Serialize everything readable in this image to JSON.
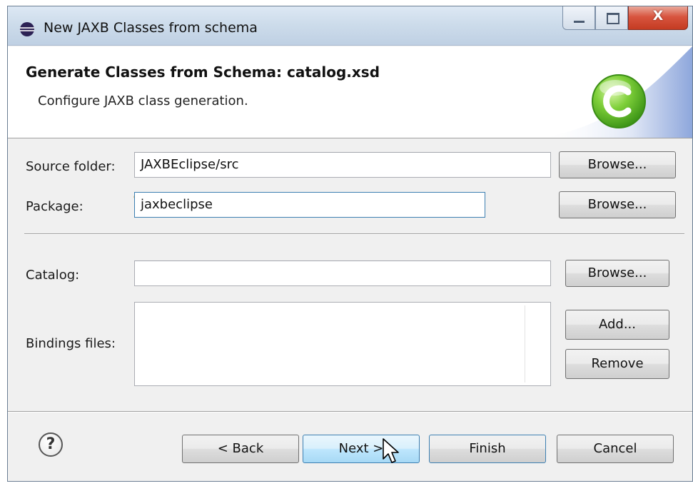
{
  "window": {
    "title": "New JAXB Classes from schema",
    "close_glyph": "X"
  },
  "header": {
    "title": "Generate Classes from Schema: catalog.xsd",
    "description": "Configure JAXB class generation.",
    "logo_icon": "eclipse-class-c-icon"
  },
  "form": {
    "source_folder": {
      "label": "Source folder:",
      "value": "JAXBEclipse/src",
      "browse_label": "Browse..."
    },
    "package": {
      "label": "Package:",
      "value": "jaxbeclipse",
      "browse_label": "Browse..."
    },
    "catalog": {
      "label": "Catalog:",
      "value": "",
      "browse_label": "Browse..."
    },
    "bindings": {
      "label": "Bindings files:",
      "add_label": "Add...",
      "remove_label": "Remove",
      "items": []
    }
  },
  "footer": {
    "help_glyph": "?",
    "back_label": "< Back",
    "next_label": "Next >",
    "finish_label": "Finish",
    "cancel_label": "Cancel"
  },
  "colors": {
    "accent_border": "#3c7fb1",
    "logo_green": "#5dbb2c"
  }
}
